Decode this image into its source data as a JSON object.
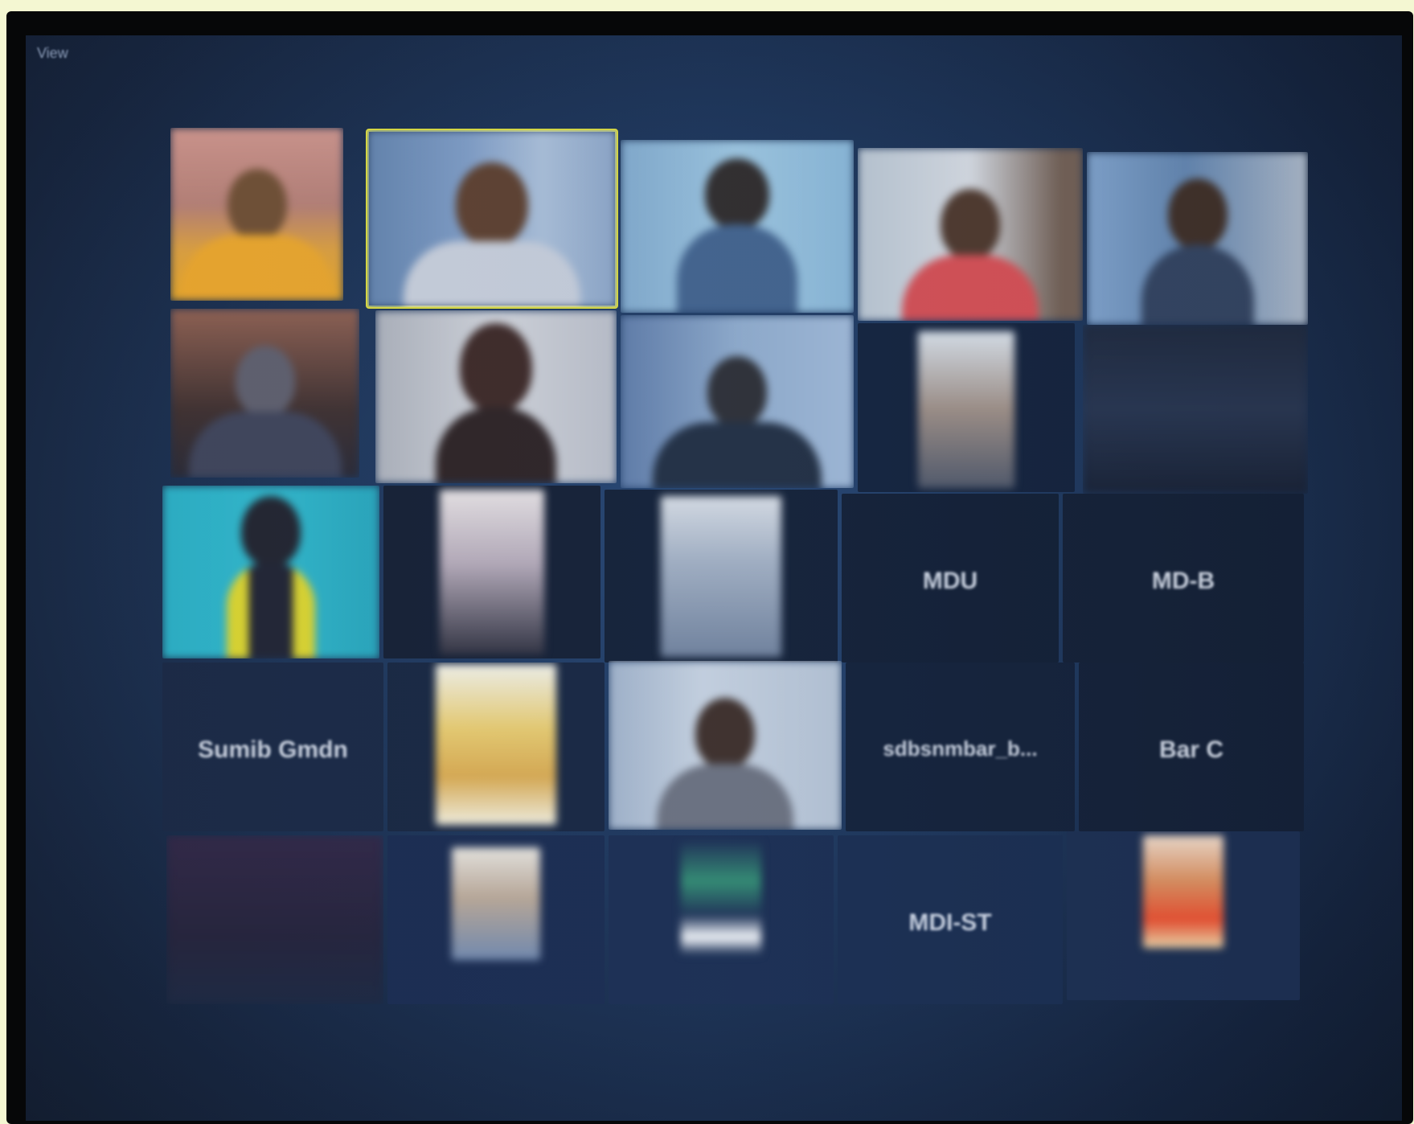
{
  "meeting": {
    "top_label": "View"
  },
  "tiles": [
    {
      "label": ""
    },
    {
      "label": ""
    },
    {
      "label": ""
    },
    {
      "label": ""
    },
    {
      "label": ""
    },
    {
      "label": ""
    },
    {
      "label": ""
    },
    {
      "label": ""
    },
    {
      "label": ""
    },
    {
      "label": ""
    },
    {
      "label": ""
    },
    {
      "label": ""
    },
    {
      "label": ""
    },
    {
      "label": "",
      "center_name": "MDU"
    },
    {
      "label": "",
      "center_name": "MD-B"
    },
    {
      "label": "",
      "center_name": "Sumib Gmdn"
    },
    {
      "label": ""
    },
    {
      "label": ""
    },
    {
      "label": "",
      "center_name": "sdbsnmbar_b..."
    },
    {
      "label": "",
      "center_name": "Bar C"
    },
    {
      "label": ""
    },
    {
      "label": ""
    },
    {
      "label": ""
    },
    {
      "label": "",
      "center_name": "MDI-ST"
    },
    {
      "label": ""
    }
  ],
  "colors": {
    "active_speaker_border": "#d8d83a",
    "screen_background": "#182f52"
  }
}
